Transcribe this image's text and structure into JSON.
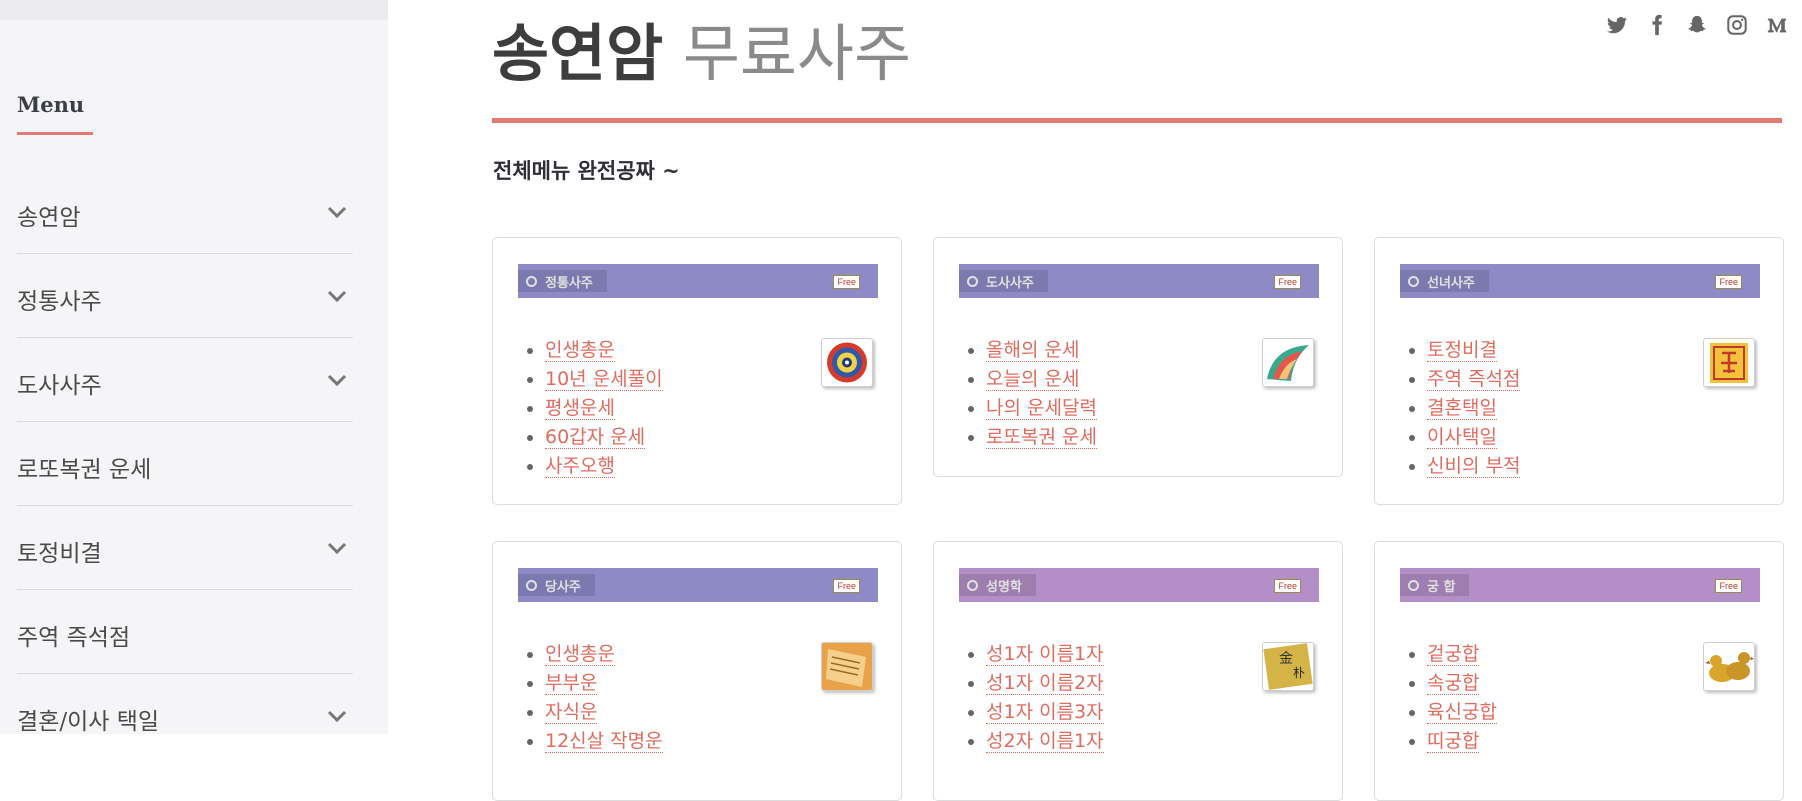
{
  "sidebar": {
    "menu_heading": "Menu",
    "items": [
      {
        "label": "송연암",
        "has_submenu": true
      },
      {
        "label": "정통사주",
        "has_submenu": true
      },
      {
        "label": "도사사주",
        "has_submenu": true
      },
      {
        "label": "로또복권 운세",
        "has_submenu": false
      },
      {
        "label": "토정비결",
        "has_submenu": true
      },
      {
        "label": "주역 즉석점",
        "has_submenu": false
      },
      {
        "label": "결혼/이사 택일",
        "has_submenu": true
      }
    ]
  },
  "header": {
    "title_main": "송연암",
    "title_sub": "무료사주",
    "subtitle": "전체메뉴 완전공짜 ~",
    "social_icons": [
      "twitter-icon",
      "facebook-icon",
      "snapchat-icon",
      "instagram-icon",
      "medium-icon"
    ]
  },
  "cards": [
    {
      "title": "정통사주",
      "badge": "Free",
      "banner_color": "#8d8ac6",
      "thumbnail_icon": "mandala-icon",
      "links": [
        "인생총운",
        "10년 운세풀이",
        "평생운세",
        "60갑자 운세",
        "사주오행"
      ]
    },
    {
      "title": "도사사주",
      "badge": "Free",
      "banner_color": "#8d8ac6",
      "thumbnail_icon": "fan-pattern-icon",
      "links": [
        "올해의 운세",
        "오늘의 운세",
        "나의 운세달력",
        "로또복권 운세"
      ]
    },
    {
      "title": "선녀사주",
      "badge": "Free",
      "banner_color": "#8d8ac6",
      "thumbnail_icon": "talisman-icon",
      "links": [
        "토정비결",
        "주역 즉석점",
        "결혼택일",
        "이사택일",
        "신비의 부적"
      ]
    },
    {
      "title": "당사주",
      "badge": "Free",
      "banner_color": "#8d8ac6",
      "thumbnail_icon": "scroll-icon",
      "links": [
        "인생총운",
        "부부운",
        "자식운",
        "12신살 작명운"
      ]
    },
    {
      "title": "성명학",
      "badge": "Free",
      "banner_color": "#b48ec7",
      "thumbnail_icon": "name-seal-icon",
      "links": [
        "성1자 이름1자",
        "성1자 이름2자",
        "성1자 이름3자",
        "성2자 이름1자"
      ]
    },
    {
      "title": "궁 합",
      "badge": "Free",
      "banner_color": "#b48ec7",
      "thumbnail_icon": "ducks-icon",
      "links": [
        "겉궁합",
        "속궁합",
        "육신궁합",
        "띠궁합"
      ]
    }
  ]
}
